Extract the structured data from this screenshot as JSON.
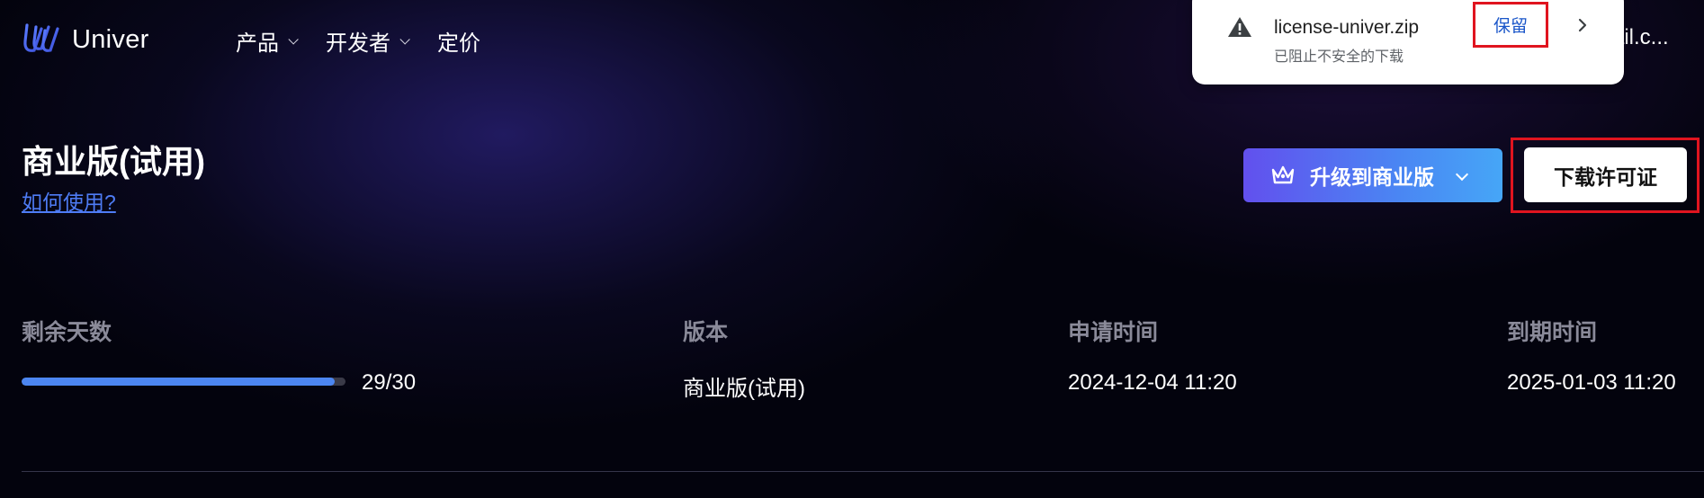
{
  "brand": {
    "name": "Univer"
  },
  "nav": {
    "items": [
      {
        "label": "产品",
        "has_dropdown": true
      },
      {
        "label": "开发者",
        "has_dropdown": true
      },
      {
        "label": "定价",
        "has_dropdown": false
      }
    ],
    "account_peek": "ail.c..."
  },
  "download_popup": {
    "filename": "license-univer.zip",
    "status": "已阻止不安全的下载",
    "keep_label": "保留",
    "icon": "warning-icon"
  },
  "header": {
    "title": "商业版(试用)",
    "help_link": "如何使用?"
  },
  "actions": {
    "upgrade_label": "升级到商业版",
    "download_license_label": "下载许可证"
  },
  "license_info": {
    "columns": {
      "remaining_days": "剩余天数",
      "edition": "版本",
      "applied_at": "申请时间",
      "expires_at": "到期时间"
    },
    "values": {
      "remaining_days": "29/30",
      "remaining_fraction": 0.967,
      "edition": "商业版(试用)",
      "applied_at": "2024-12-04 11:20",
      "expires_at": "2025-01-03 11:20"
    }
  },
  "colors": {
    "accent_blue": "#4c86f1",
    "upgrade_gradient_start": "#6250ee",
    "upgrade_gradient_end": "#46a6f7",
    "highlight_red": "#e0141f",
    "link_blue": "#4e7cf5"
  }
}
